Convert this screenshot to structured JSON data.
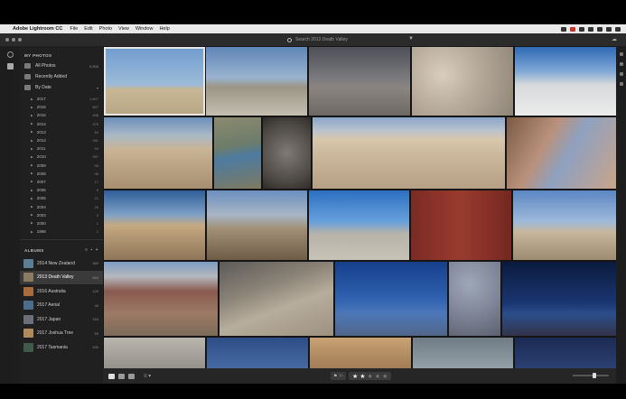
{
  "menubar": {
    "app_name": "Adobe Lightroom CC",
    "items": [
      "File",
      "Edit",
      "Photo",
      "View",
      "Window",
      "Help"
    ]
  },
  "titlebar": {
    "search_placeholder": "Search 2013 Death Valley"
  },
  "sidebar": {
    "section_title": "MY PHOTOS",
    "library": [
      {
        "label": "All Photos",
        "count": "9,806"
      },
      {
        "label": "Recently Added",
        "count": ""
      },
      {
        "label": "By Date",
        "count": ""
      }
    ],
    "years": [
      {
        "label": "2017",
        "count": "1,607"
      },
      {
        "label": "2016",
        "count": "867"
      },
      {
        "label": "2015",
        "count": "488"
      },
      {
        "label": "2014",
        "count": "375"
      },
      {
        "label": "2013",
        "count": "84"
      },
      {
        "label": "2012",
        "count": "281"
      },
      {
        "label": "2011",
        "count": "99"
      },
      {
        "label": "2010",
        "count": "287"
      },
      {
        "label": "2009",
        "count": "55"
      },
      {
        "label": "2008",
        "count": "96"
      },
      {
        "label": "2007",
        "count": "17"
      },
      {
        "label": "2006",
        "count": "9"
      },
      {
        "label": "2005",
        "count": "21"
      },
      {
        "label": "2004",
        "count": "25"
      },
      {
        "label": "2003",
        "count": "3"
      },
      {
        "label": "2000",
        "count": "1"
      },
      {
        "label": "1998",
        "count": "1"
      }
    ],
    "albums_title": "ALBUMS",
    "albums": [
      {
        "label": "2014 New Zealand",
        "count": "369",
        "thumb_color": "#5d7e96",
        "selected": false
      },
      {
        "label": "2013 Death Valley",
        "count": "866",
        "thumb_color": "#8c7a62",
        "selected": true
      },
      {
        "label": "2016 Australia",
        "count": "129",
        "thumb_color": "#a86b3c",
        "selected": false
      },
      {
        "label": "2017 Aerial",
        "count": "40",
        "thumb_color": "#4a6d8c",
        "selected": false
      },
      {
        "label": "2017 Japan",
        "count": "153",
        "thumb_color": "#6b6f78",
        "selected": false
      },
      {
        "label": "2017 Joshua Tree",
        "count": "59",
        "thumb_color": "#b08a5a",
        "selected": false
      },
      {
        "label": "2017 Tasmania",
        "count": "180",
        "thumb_color": "#3f5a48",
        "selected": false
      }
    ]
  },
  "toolbar": {
    "rating_stars": 2,
    "rating_max": 5
  },
  "photos": [
    {
      "name": "photo-tree-fence",
      "bg": "linear-gradient(180deg,#6f9ccd 0%,#9cbbd9 55%,#c9b895 62%,#b8a583 100%)",
      "selected": true
    },
    {
      "name": "photo-signpost-playa",
      "bg": "linear-gradient(180deg,#5f86b8 0%,#9ab3cf 45%,#9c9585 58%,#c4bfb2 100%)"
    },
    {
      "name": "photo-dusk-flats",
      "bg": "linear-gradient(180deg,#4e5057 0%,#7a7a7e 45%,#8b8580 60%,#6d6863 100%)"
    },
    {
      "name": "photo-cracked-mud",
      "bg": "radial-gradient(circle at 30% 40%,#d9cdbd 0%,#b9ad9e 40%,#8e8477 100%)"
    },
    {
      "name": "photo-salt-flats",
      "bg": "linear-gradient(180deg,#2f6ab4 0%,#7fa7d6 35%,#d6d8da 55%,#ececec 100%)"
    },
    {
      "name": "photo-road-dunes",
      "bg": "linear-gradient(180deg,#6b8fb8 0%,#a9b8c6 25%,#c9b496 45%,#a88e70 100%)"
    },
    {
      "name": "photo-creek",
      "bg": "linear-gradient(170deg,#8c8a70 0%,#6d7c6a 40%,#4d7ba0 55%,#7d7a60 100%)"
    },
    {
      "name": "photo-dead-branches",
      "bg": "radial-gradient(circle at 50% 50%,#7f7a75 0%,#4a4642 70%,#2d2b29 100%)"
    },
    {
      "name": "photo-sand-dunes",
      "bg": "linear-gradient(180deg,#8aa5c8 0%,#b9c3cf 18%,#d7c7ad 30%,#c8b497 60%,#b5a085 100%)"
    },
    {
      "name": "photo-canyon-wash",
      "bg": "linear-gradient(120deg,#7b5a44 0%,#b9917a 35%,#8fa1c0 55%,#c9a488 100%)"
    },
    {
      "name": "photo-desert-highway",
      "bg": "linear-gradient(180deg,#2e5f99 0%,#7ea1c6 35%,#c5a982 50%,#8e7658 100%)"
    },
    {
      "name": "photo-dead-tree-sunset",
      "bg": "linear-gradient(180deg,#6c8fc0 0%,#a7b5c5 35%,#a19076 55%,#6e5c48 100%)"
    },
    {
      "name": "photo-rusty-tank",
      "bg": "linear-gradient(180deg,#2c6fc0 0%,#68a0dc 45%,#b7b3a9 62%,#c7c2b6 100%)"
    },
    {
      "name": "photo-union-sign",
      "bg": "linear-gradient(90deg,#7a2c24 0%,#9a3a2f 50%,#742820 100%)"
    },
    {
      "name": "photo-rhyolite-ruins",
      "bg": "linear-gradient(180deg,#5b87c4 0%,#9fb9d8 45%,#c6b79c 60%,#9d8b72 100%)"
    },
    {
      "name": "photo-red-hills",
      "bg": "linear-gradient(180deg,#7e9cc4 0%,#b4b8bd 20%,#8a5a4e 40%,#9c7a66 70%,#7c6a58 100%)"
    },
    {
      "name": "photo-dirt-road-cliffs",
      "bg": "linear-gradient(160deg,#5c5b59 0%,#8a8276 35%,#b7ad9d 60%,#9d9180 100%)"
    },
    {
      "name": "photo-bank-ruins-blue",
      "bg": "linear-gradient(180deg,#163f8a 0%,#2f62b0 50%,#4d77b8 70%,#506688 100%)"
    },
    {
      "name": "photo-rock-texture",
      "bg": "radial-gradient(circle at 40% 30%,#9ea8b8 0%,#7f8697 50%,#5c6170 100%)"
    },
    {
      "name": "photo-night-ruins",
      "bg": "linear-gradient(180deg,#0a1a3d 0%,#1a3670 55%,#2a4d8a 70%,#33344a 100%)"
    },
    {
      "name": "photo-rocks-bottom",
      "bg": "linear-gradient(180deg,#b9b6ae 0%,#8e8a84 100%)"
    },
    {
      "name": "photo-blue-dusk",
      "bg": "linear-gradient(180deg,#2d4d86 0%,#4c6fa8 100%)"
    },
    {
      "name": "photo-sand-ripples",
      "bg": "linear-gradient(180deg,#c9a274 0%,#9a7650 100%)"
    },
    {
      "name": "photo-interior-ruin",
      "bg": "linear-gradient(180deg,#6f7c86 0%,#9aa7ad 100%)"
    },
    {
      "name": "photo-starry-sky",
      "bg": "linear-gradient(180deg,#1b2a52 0%,#2e4478 100%)"
    }
  ]
}
